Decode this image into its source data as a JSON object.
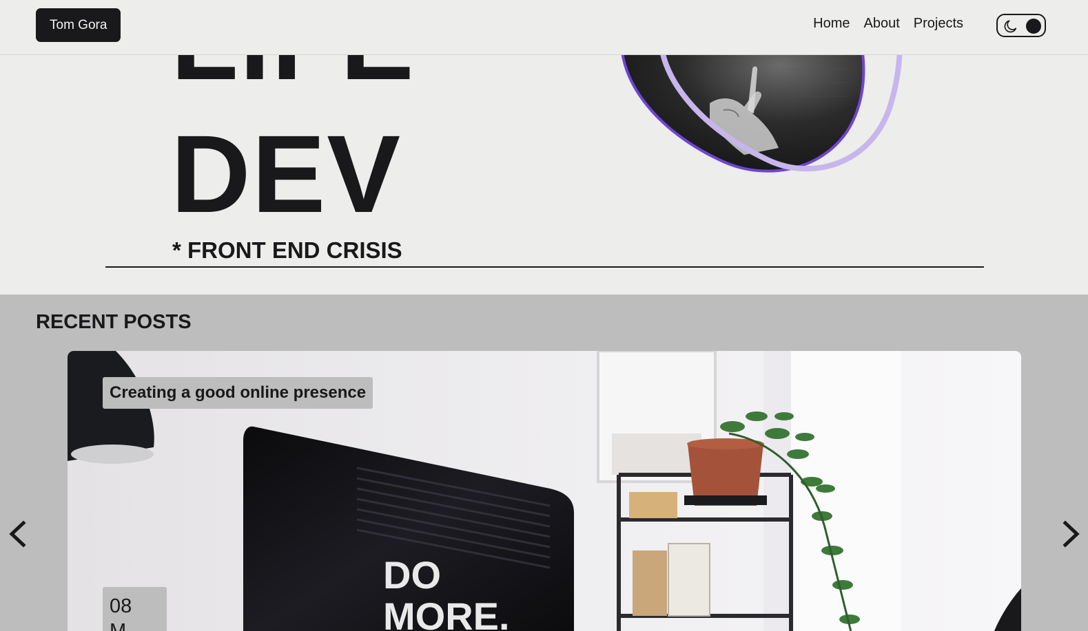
{
  "header": {
    "brand": "Tom Gora",
    "nav": [
      "Home",
      "About",
      "Projects"
    ]
  },
  "hero": {
    "line1": "LIFE",
    "line2": "DEV",
    "subtitle": "* FRONT END CRISIS"
  },
  "posts": {
    "heading": "RECENT POSTS",
    "card": {
      "title": "Creating a good online presence",
      "date_day": "08",
      "date_month": "M",
      "poster_line1": "DO",
      "poster_line2": "MORE."
    }
  },
  "colors": {
    "background": "#ededeb",
    "dark": "#19181a",
    "accent_purple": "#6f45d6",
    "accent_lilac": "#c6b6ec",
    "posts_bg": "#bdbdbd"
  },
  "icons": [
    "moon-icon",
    "chevron-left-icon",
    "chevron-right-icon"
  ]
}
